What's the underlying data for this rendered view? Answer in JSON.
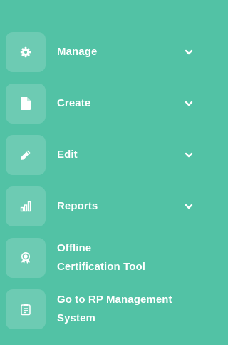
{
  "menu": {
    "items": [
      {
        "label": "Manage",
        "icon": "gear-icon",
        "has_dropdown": true
      },
      {
        "label": "Create",
        "icon": "document-icon",
        "has_dropdown": true
      },
      {
        "label": "Edit",
        "icon": "pencil-icon",
        "has_dropdown": true
      },
      {
        "label": "Reports",
        "icon": "bar-chart-icon",
        "has_dropdown": true
      },
      {
        "label_line1": "Offline",
        "label_line2": "Certification Tool",
        "icon": "certificate-icon",
        "has_dropdown": false
      },
      {
        "label_line1": "Go to RP Management",
        "label_line2": "System",
        "icon": "clipboard-icon",
        "has_dropdown": false
      }
    ]
  },
  "colors": {
    "background": "#52c2a5",
    "icon_box": "rgba(255,255,255,0.16)",
    "text": "#ffffff"
  }
}
